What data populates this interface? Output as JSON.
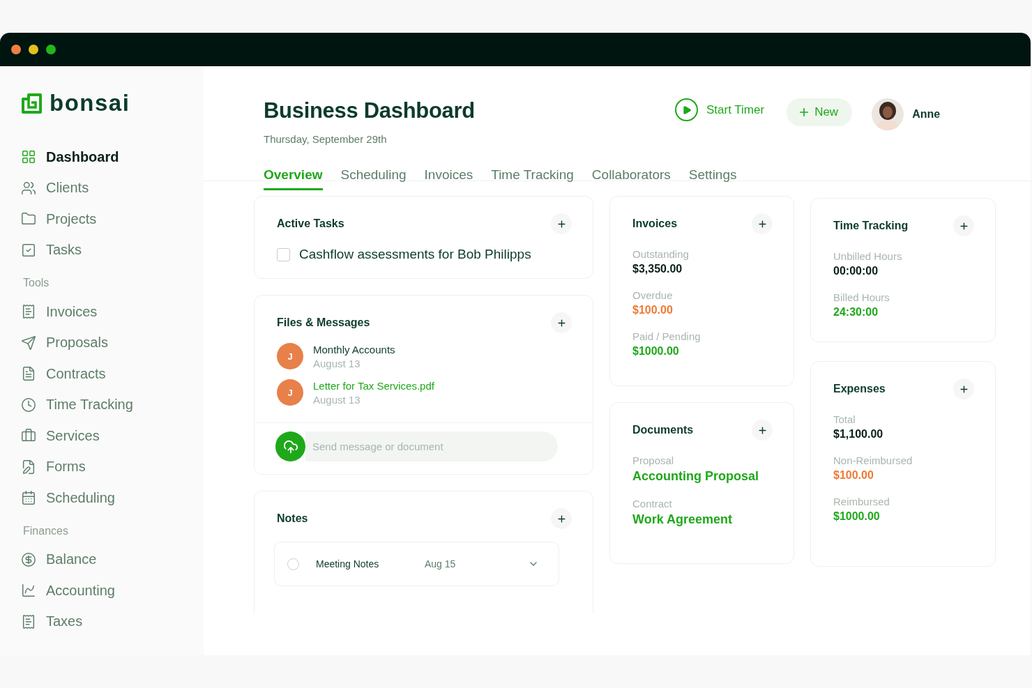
{
  "brand": {
    "name": "bonsai"
  },
  "sidebar": {
    "items": [
      {
        "label": "Dashboard",
        "selected": true
      },
      {
        "label": "Clients",
        "selected": false
      },
      {
        "label": "Projects",
        "selected": false
      },
      {
        "label": "Tasks",
        "selected": false
      }
    ],
    "sections": [
      {
        "title": "Tools",
        "items": [
          {
            "label": "Invoices",
            "selected": false
          },
          {
            "label": "Proposals",
            "selected": false
          },
          {
            "label": "Contracts",
            "selected": false
          },
          {
            "label": "Time Tracking",
            "selected": false
          },
          {
            "label": "Services",
            "selected": false
          },
          {
            "label": "Forms",
            "selected": false
          },
          {
            "label": "Scheduling",
            "selected": false
          }
        ]
      },
      {
        "title": "Finances",
        "items": [
          {
            "label": "Balance",
            "selected": false
          },
          {
            "label": "Accounting",
            "selected": false
          },
          {
            "label": "Taxes",
            "selected": false
          }
        ]
      }
    ]
  },
  "header": {
    "title": "Business Dashboard",
    "date": "Thursday, September 29th",
    "timer_button": "Start Timer",
    "new_button": "New",
    "user": "Anne"
  },
  "tabs": [
    {
      "label": "Overview",
      "selected": true
    },
    {
      "label": "Scheduling",
      "selected": false
    },
    {
      "label": "Invoices",
      "selected": false
    },
    {
      "label": "Time Tracking",
      "selected": false
    },
    {
      "label": "Collaborators",
      "selected": false
    },
    {
      "label": "Settings",
      "selected": false
    }
  ],
  "active_tasks": {
    "title": "Active Tasks",
    "tasks": [
      {
        "label": "Cashflow assessments for Bob Philipps",
        "checked": false
      }
    ]
  },
  "files_messages": {
    "title": "Files & Messages",
    "items": [
      {
        "kind": "message",
        "initial": "J",
        "color": "#e8804a",
        "title": "Monthly Accounts",
        "date": "August 13"
      },
      {
        "kind": "file",
        "initial": "J",
        "color": "#e8804a",
        "title": "Letter for Tax Services.pdf",
        "date": "August 13"
      }
    ],
    "compose": {
      "placeholder": "Send message or document"
    }
  },
  "notes": {
    "title": "Notes",
    "items": [
      {
        "title": "Meeting Notes",
        "date": "Aug 15",
        "checked": false
      }
    ]
  },
  "invoices": {
    "title": "Invoices",
    "stats": [
      {
        "label": "Outstanding",
        "value": "$3,350.00",
        "kind": "neutral"
      },
      {
        "label": "Overdue",
        "value": "$100.00",
        "kind": "overdue"
      },
      {
        "label": "Paid / Pending",
        "value": "$1000.00",
        "kind": "positive"
      }
    ]
  },
  "documents": {
    "title": "Documents",
    "stats": [
      {
        "label": "Proposal",
        "value": "Accounting Proposal",
        "kind": "link"
      },
      {
        "label": "Contract",
        "value": "Work Agreement",
        "kind": "link"
      }
    ]
  },
  "time_tracking": {
    "title": "Time Tracking",
    "stats": [
      {
        "label": "Unbilled Hours",
        "value": "00:00:00",
        "kind": "neutral"
      },
      {
        "label": "Billed Hours",
        "value": "24:30:00",
        "kind": "positive"
      }
    ]
  },
  "expenses": {
    "title": "Expenses",
    "stats": [
      {
        "label": "Total",
        "value": "$1,100.00",
        "kind": "neutral"
      },
      {
        "label": "Non-Reimbursed",
        "value": "$100.00",
        "kind": "overdue"
      },
      {
        "label": "Reimbursed",
        "value": "$1000.00",
        "kind": "positive"
      }
    ]
  }
}
